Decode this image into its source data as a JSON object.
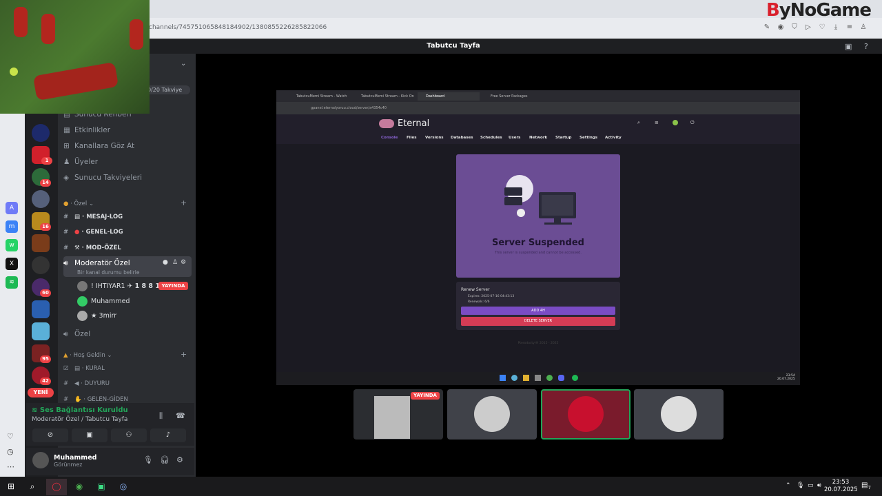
{
  "browser": {
    "url": "channels/745751065848184902/1380855226285822066",
    "brand": "ByNoGame",
    "brand_r": "B",
    "brand_rest": "yNoGame"
  },
  "discord": {
    "title": "Tabutcu Tayfa",
    "boost_label": "0/20 Takviye",
    "menu": [
      "Sunucu Rehberi",
      "Etkinlikler",
      "Kanallara Göz At",
      "Üyeler",
      "Sunucu Takviyeleri"
    ],
    "category_ozel": "Özel",
    "text_channels": [
      "MESAJ-LOG",
      "GENEL-LOG",
      "MOD-ÖZEL"
    ],
    "voice_selected": "Moderatör Özel",
    "voice_status_hint": "Bir kanal durumu belirle",
    "voice_users": [
      {
        "name": "! IHTIYAR1",
        "tag": "1 8 8 1",
        "live": "YAYINDA"
      },
      {
        "name": "Muhammed"
      },
      {
        "name": "★ 3mirr"
      }
    ],
    "voice_ozel": "Özel",
    "category_hosgeldin": "Hoş Geldin",
    "channels2": [
      "KURAL",
      "DUYURU",
      "GELEN-GİDEN"
    ],
    "server_badges": [
      "1",
      "14",
      "16",
      "60",
      "95",
      "42"
    ],
    "new_label": "YENİ",
    "connection": {
      "status": "Ses Bağlantısı Kuruldu",
      "channel": "Moderatör Özel / Tabutcu Tayfa"
    },
    "user": {
      "name": "Muhammed",
      "status": "Görünmez"
    }
  },
  "stream": {
    "tabs": [
      "TabutcuMemi Stream - Watch",
      "TabutcuMemi Stream - Kick On",
      "Dashboard",
      "Free Server Packages"
    ],
    "url": "gpanel.eternalyoruu.cloud/server/a4354c40",
    "app_name": "Eternal",
    "nav": [
      "Console",
      "Files",
      "Versions",
      "Databases",
      "Schedules",
      "Users",
      "Network",
      "Startup",
      "Settings",
      "Activity"
    ],
    "suspended_title": "Server Suspended",
    "suspended_sub": "This server is suspended and cannot be accessed.",
    "renew_title": "Renew Server",
    "expires": "Expires: 2025-07-16 04:43:13",
    "renewals": "Renewals: 6/6",
    "add_button": "ADD 4H",
    "delete_button": "DELETE SERVER",
    "footer": "Pterodactyl® 2015 - 2025",
    "clock_time": "23:54",
    "clock_date": "20.07.2025"
  },
  "tile_live": "YAYINDA",
  "taskbar": {
    "time": "23:53",
    "date": "20.07.2025",
    "notif": "7"
  },
  "colors": {
    "discord_bg": "#1e1f22",
    "accent_green": "#23a559",
    "live_red": "#ed4245",
    "eternal_purple": "#6b4d94"
  }
}
